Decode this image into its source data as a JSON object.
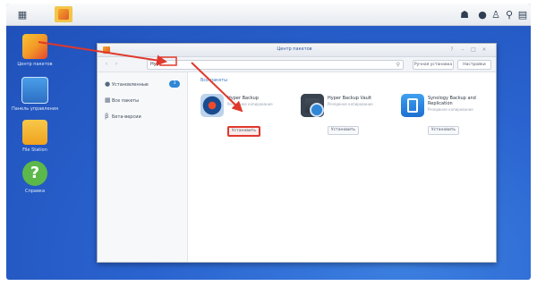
{
  "colors": {
    "accent_red": "#e0382c",
    "desktop_blue": "#2a63cf",
    "link_blue": "#3d7bc6"
  },
  "taskbar": {
    "left_icons": [
      "grid-icon",
      "package-center-icon"
    ],
    "tray_icons": [
      "user-icon",
      "notification-icon",
      "person-icon",
      "search-icon",
      "widget-icon"
    ]
  },
  "desktop": {
    "icons": [
      {
        "name": "package-center",
        "label": "Центр пакетов"
      },
      {
        "name": "control-panel",
        "label": "Панель управления"
      },
      {
        "name": "file-station",
        "label": "File Station"
      },
      {
        "name": "help",
        "label": "Справка"
      }
    ]
  },
  "window": {
    "title": "Центр пакетов",
    "search_typed": "Hyp",
    "buttons": {
      "manual_install": "Ручная установка",
      "settings": "Настройки"
    },
    "sidebar": [
      {
        "label": "Установленные",
        "icon": "installed-icon",
        "badge": "3"
      },
      {
        "label": "Все пакеты",
        "icon": "all-packages-icon",
        "badge": ""
      },
      {
        "label": "Бета-версии",
        "icon": "beta-icon",
        "badge": ""
      }
    ],
    "section_title": "Все пакеты",
    "packages": [
      {
        "name": "Hyper Backup",
        "sub": "Резервное копирование",
        "button": "Установить",
        "highlighted": true
      },
      {
        "name": "Hyper Backup Vault",
        "sub": "Резервное копирование",
        "button": "Установить",
        "highlighted": false
      },
      {
        "name": "Synology Backup and Replication",
        "sub": "Резервное копирование",
        "button": "Установить",
        "highlighted": false
      }
    ]
  }
}
